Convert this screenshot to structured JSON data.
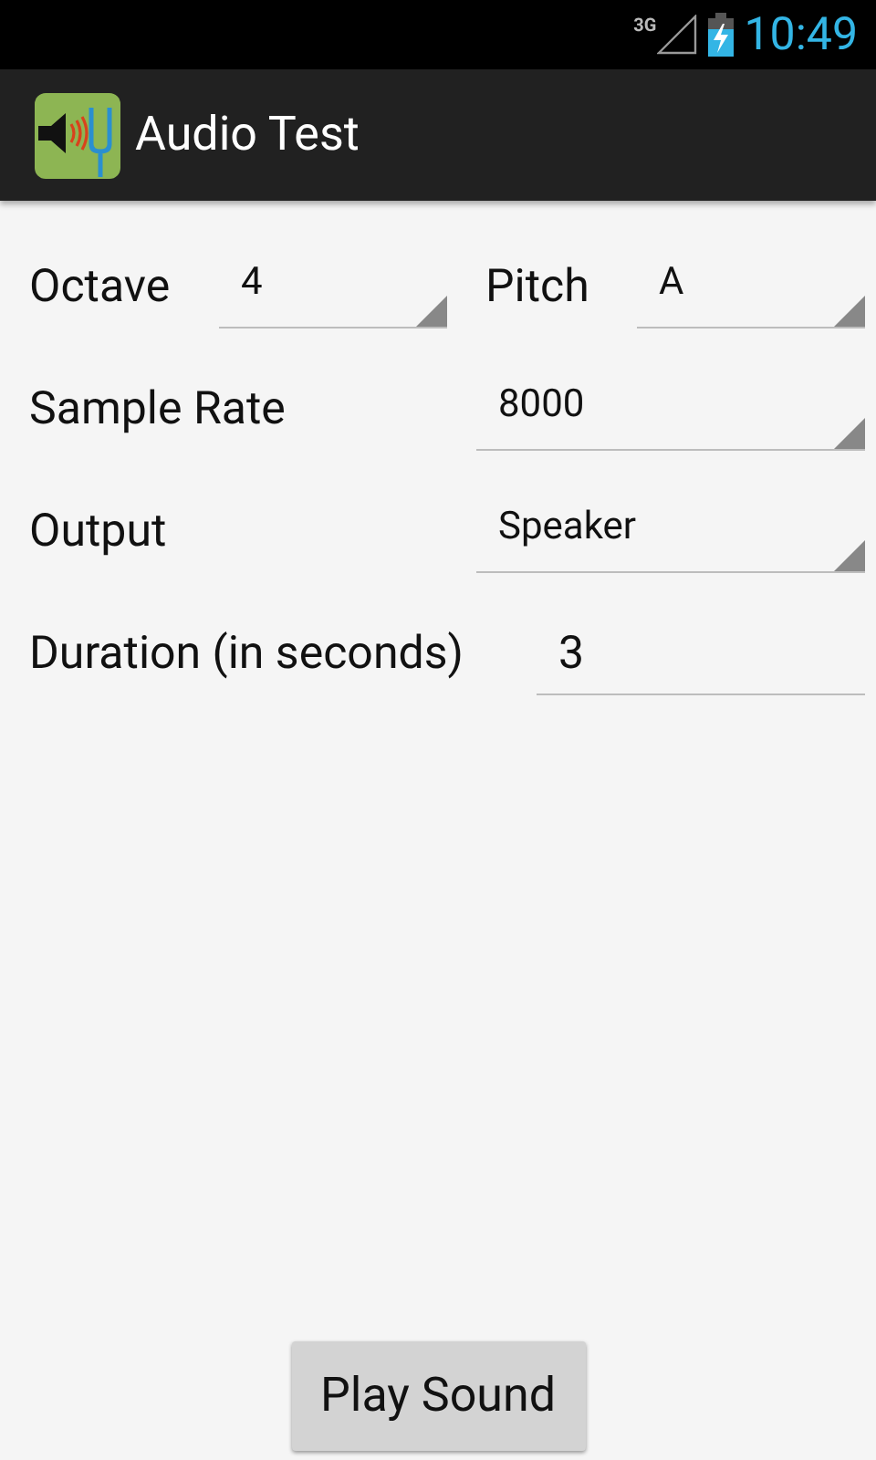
{
  "status_bar": {
    "network": "3G",
    "time": "10:49"
  },
  "app_bar": {
    "title": "Audio Test"
  },
  "form": {
    "rows": [
      {
        "fields": [
          {
            "kind": "spinner",
            "label": "Octave",
            "value": "4"
          },
          {
            "kind": "spinner",
            "label": "Pitch",
            "value": "A"
          }
        ]
      },
      {
        "fields": [
          {
            "kind": "spinner",
            "label": "Sample Rate",
            "value": "8000"
          }
        ]
      },
      {
        "fields": [
          {
            "kind": "spinner",
            "label": "Output",
            "value": "Speaker"
          }
        ]
      },
      {
        "fields": [
          {
            "kind": "text_input",
            "label": "Duration (in seconds)",
            "value": "3"
          }
        ]
      }
    ]
  },
  "button": {
    "label": "Play Sound"
  }
}
